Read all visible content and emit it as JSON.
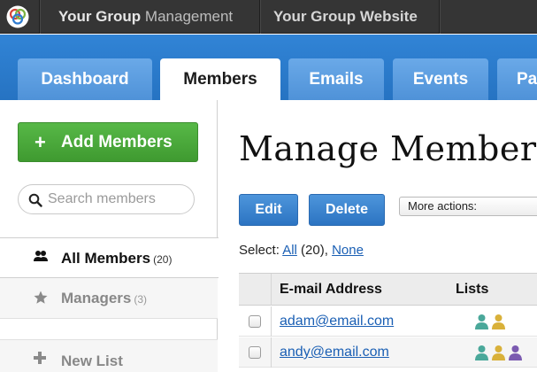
{
  "topbar": {
    "app_name_bold": "Your Group",
    "app_name_light": "Management",
    "website_link": "Your Group Website"
  },
  "tabs": [
    {
      "label": "Dashboard",
      "active": false
    },
    {
      "label": "Members",
      "active": true
    },
    {
      "label": "Emails",
      "active": false
    },
    {
      "label": "Events",
      "active": false
    },
    {
      "label": "Pa",
      "active": false
    }
  ],
  "sidebar": {
    "add_button": "Add Members",
    "search_placeholder": "Search members",
    "items": [
      {
        "label": "All Members",
        "count": "(20)",
        "icon": "people-icon"
      },
      {
        "label": "Managers",
        "count": "(3)",
        "icon": "star-icon"
      },
      {
        "label": "New List",
        "count": "",
        "icon": "plus-icon"
      }
    ]
  },
  "main": {
    "title": "Manage Members",
    "edit_button": "Edit",
    "delete_button": "Delete",
    "more_actions": "More actions:",
    "select_label": "Select:",
    "select_all": "All",
    "select_count": "(20),",
    "select_none": "None"
  },
  "table": {
    "headers": {
      "email": "E-mail Address",
      "lists": "Lists"
    },
    "rows": [
      {
        "email": "adam@email.com",
        "lists": [
          "teal",
          "gold"
        ]
      },
      {
        "email": "andy@email.com",
        "lists": [
          "teal",
          "gold",
          "purple"
        ]
      }
    ]
  },
  "colors": {
    "topbar": "#353535",
    "tab_band": "#2a7acb",
    "add_button": "#4aa83a",
    "action_button": "#3a84d0",
    "link": "#1a5fb4",
    "list_teal": "#4aa89a",
    "list_gold": "#d9b13a",
    "list_purple": "#7b5ab0"
  }
}
